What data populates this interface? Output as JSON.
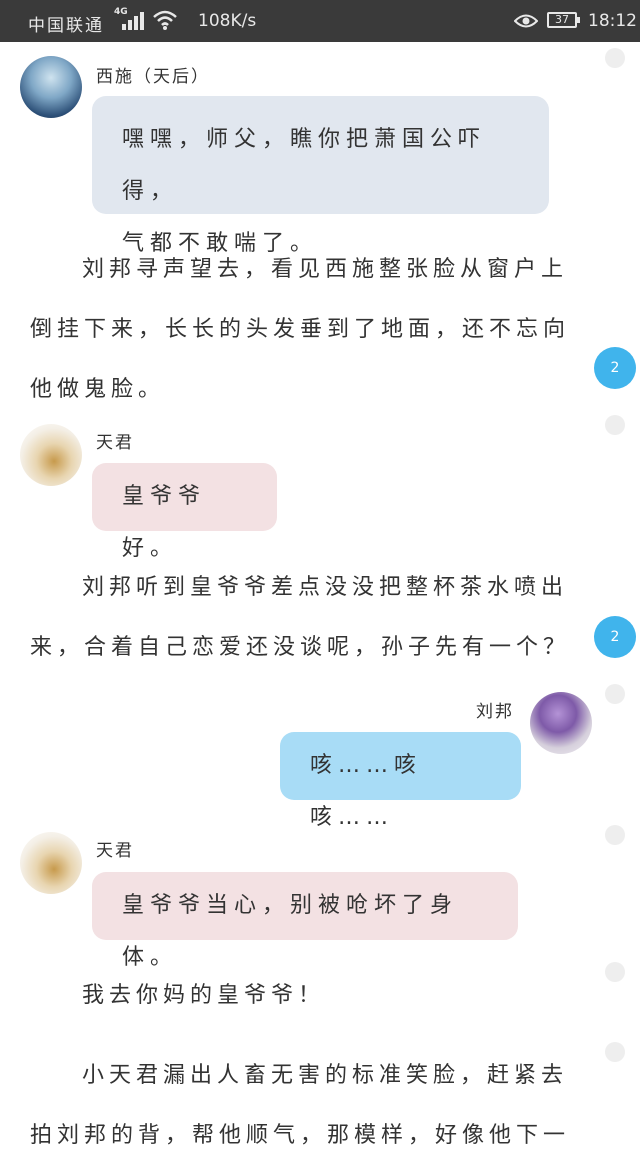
{
  "status_bar": {
    "carrier": "中国联通",
    "network": "4G",
    "speed": "108K/s",
    "battery": "37",
    "time": "18:12"
  },
  "messages": [
    {
      "speaker": "西施（天后）",
      "text_lines": [
        "嘿嘿，师父，瞧你把萧国公吓得，",
        "气都不敢喘了。"
      ]
    },
    {
      "narration_lines": [
        "刘邦寻声望去，看见西施整张脸从窗户上",
        "倒挂下来，长长的头发垂到了地面，还不忘向",
        "他做鬼脸。"
      ]
    },
    {
      "speaker": "天君",
      "text_lines": [
        "皇爷爷好。"
      ]
    },
    {
      "narration_lines": [
        "刘邦听到皇爷爷差点没没把整杯茶水喷出",
        "来，合着自己恋爱还没谈呢，孙子先有一个？"
      ]
    },
    {
      "speaker": "刘邦",
      "text_lines": [
        "咳……咳咳……"
      ]
    },
    {
      "speaker": "天君",
      "text_lines": [
        "皇爷爷当心，别被呛坏了身体。"
      ]
    },
    {
      "narration_lines": [
        "我去你妈的皇爷爷！"
      ]
    },
    {
      "narration_lines": [
        "小天君漏出人畜无害的标准笑脸，赶紧去",
        "拍刘邦的背，帮他顺气，那模样，好像他下一"
      ]
    }
  ],
  "side_badges": [
    "2",
    "2"
  ],
  "icons": [
    "signal-icon",
    "wifi-icon",
    "eye-icon",
    "battery-icon",
    "avatar"
  ],
  "colors": {
    "status_bg": "#3a3a3a",
    "bubble_blue": "#e1e7ef",
    "bubble_pink": "#f3e1e3",
    "bubble_sky": "#a8dcf6",
    "badge": "#40b4ec"
  }
}
